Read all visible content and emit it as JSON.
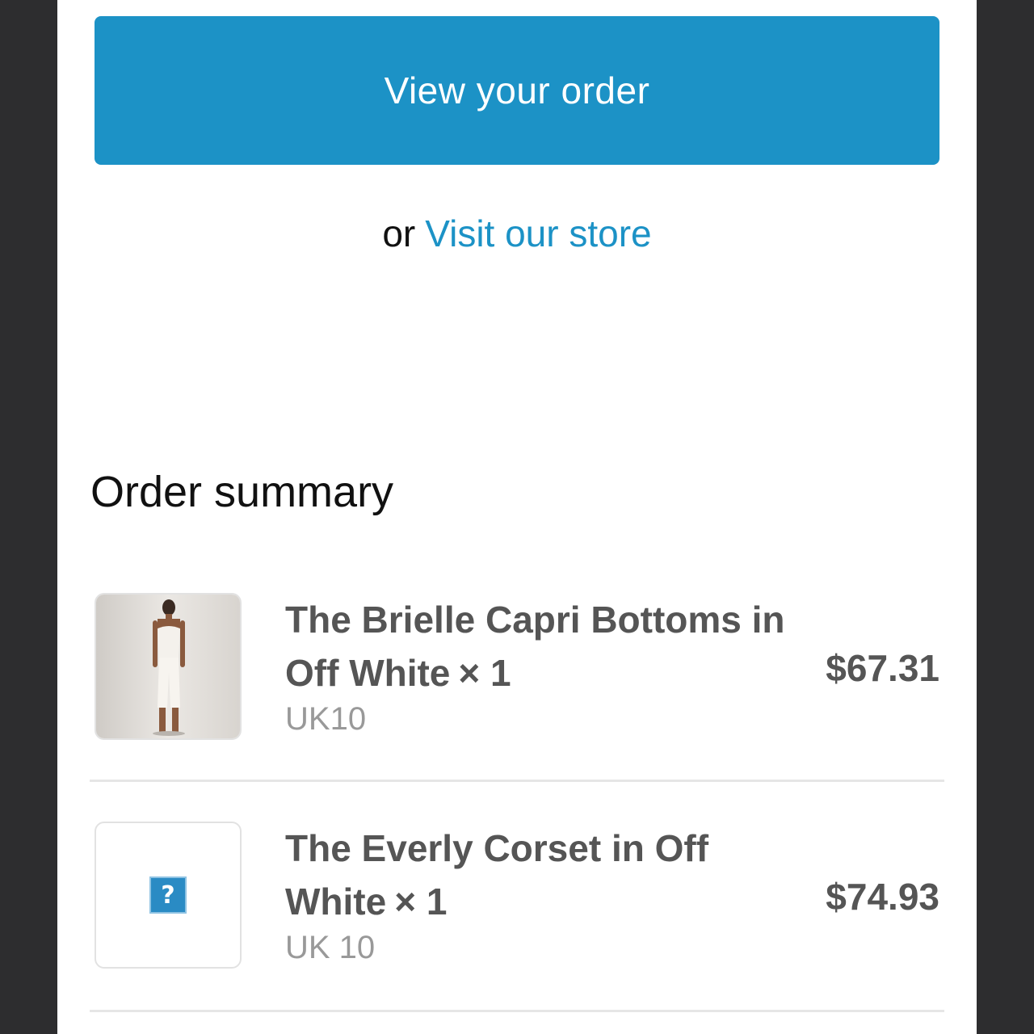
{
  "actions": {
    "view_order_label": "View your order",
    "or_text": "or",
    "visit_store_label": "Visit our store"
  },
  "summary": {
    "title": "Order summary"
  },
  "items": [
    {
      "name": "The Brielle Capri Bottoms in Off White",
      "quantity": "× 1",
      "variant": "UK10",
      "price": "$67.31",
      "thumbnail": "product-photo"
    },
    {
      "name": "The Everly Corset in Off White",
      "quantity": "× 1",
      "variant": "UK 10",
      "price": "$74.93",
      "thumbnail": "missing-image-icon"
    }
  ],
  "colors": {
    "accent": "#1c92c6",
    "text_dark": "#555555",
    "text_muted": "#999999"
  }
}
